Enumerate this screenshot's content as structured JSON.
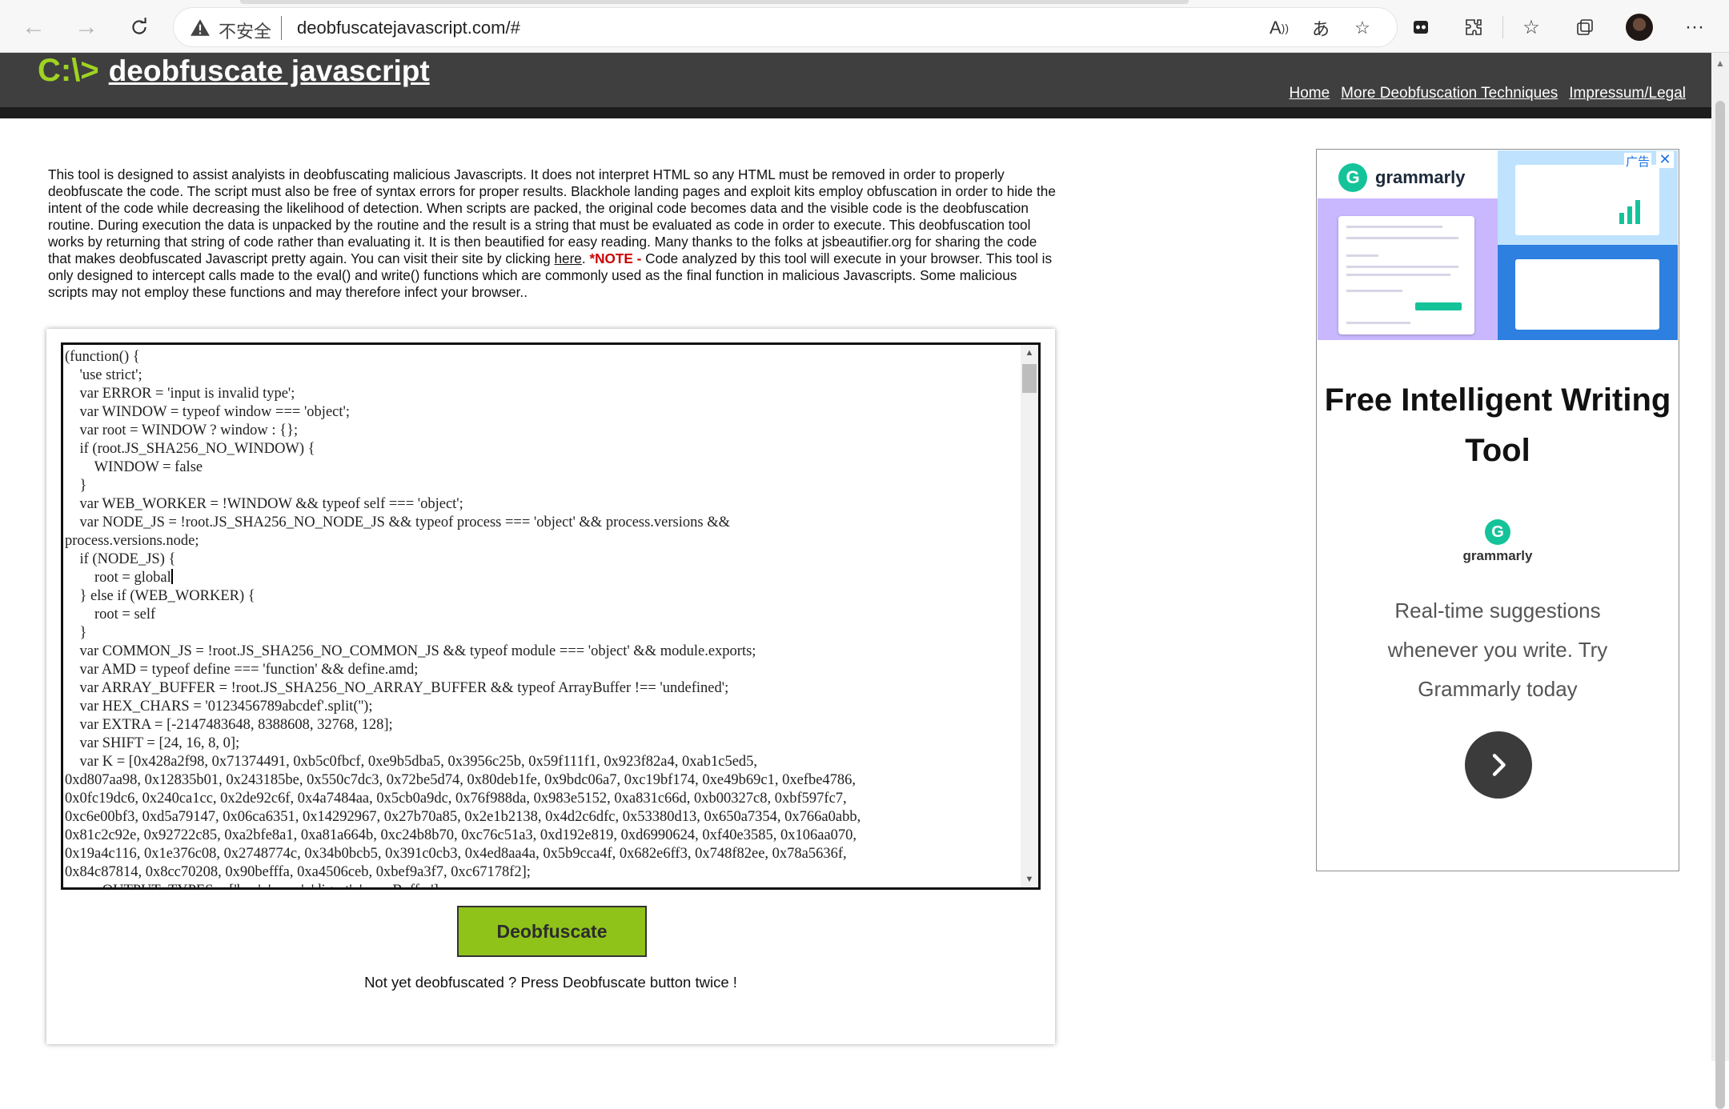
{
  "browser": {
    "back_icon": "back-arrow-icon",
    "forward_icon": "forward-arrow-icon",
    "reload_icon": "reload-icon",
    "security_label": "不安全",
    "url": "deobfuscatejavascript.com/#"
  },
  "site": {
    "logo_prompt": "C:\\>",
    "title": "deobfuscate javascript",
    "nav": [
      "Home",
      "More Deobfuscation Techniques",
      "Impressum/Legal"
    ]
  },
  "intro": {
    "text_before_link": "This tool is designed to assist analyists in deobfuscating malicious Javascripts. It does not interpret HTML so any HTML must be removed in order to properly deobfuscate the code. The script must also be free of syntax errors for proper results. Blackhole landing pages and exploit kits employ obfuscation in order to hide the intent of the code while decreasing the likelihood of detection. When scripts are packed, the original code becomes data and the visible code is the deobfuscation routine. During execution the data is unpacked by the routine and the result is a string that must be evaluated as code in order to execute. This deobfuscation tool works by returning that string of code rather than evaluating it. It is then beautified for easy reading. Many thanks to the folks at jsbeautifier.org for sharing the code that makes deobfuscated Javascript pretty again. You can visit their site by clicking ",
    "link": "here",
    "after_link": ". ",
    "note_label": "*NOTE -",
    "text_after_note": " Code analyzed by this tool will execute in your browser. This tool is only designed to intercept calls made to the eval() and write() functions which are commonly used as the final function in malicious Javascripts. Some malicious scripts may not employ these functions and may therefore infect your browser.."
  },
  "editor": {
    "code_before_caret": "(function() {\n    'use strict';\n    var ERROR = 'input is invalid type';\n    var WINDOW = typeof window === 'object';\n    var root = WINDOW ? window : {};\n    if (root.JS_SHA256_NO_WINDOW) {\n        WINDOW = false\n    }\n    var WEB_WORKER = !WINDOW && typeof self === 'object';\n    var NODE_JS = !root.JS_SHA256_NO_NODE_JS && typeof process === 'object' && process.versions &&\nprocess.versions.node;\n    if (NODE_JS) {\n        root = global",
    "code_after_caret": "\n    } else if (WEB_WORKER) {\n        root = self\n    }\n    var COMMON_JS = !root.JS_SHA256_NO_COMMON_JS && typeof module === 'object' && module.exports;\n    var AMD = typeof define === 'function' && define.amd;\n    var ARRAY_BUFFER = !root.JS_SHA256_NO_ARRAY_BUFFER && typeof ArrayBuffer !== 'undefined';\n    var HEX_CHARS = '0123456789abcdef'.split('');\n    var EXTRA = [-2147483648, 8388608, 32768, 128];\n    var SHIFT = [24, 16, 8, 0];\n    var K = [0x428a2f98, 0x71374491, 0xb5c0fbcf, 0xe9b5dba5, 0x3956c25b, 0x59f111f1, 0x923f82a4, 0xab1c5ed5,\n0xd807aa98, 0x12835b01, 0x243185be, 0x550c7dc3, 0x72be5d74, 0x80deb1fe, 0x9bdc06a7, 0xc19bf174, 0xe49b69c1, 0xefbe4786,\n0x0fc19dc6, 0x240ca1cc, 0x2de92c6f, 0x4a7484aa, 0x5cb0a9dc, 0x76f988da, 0x983e5152, 0xa831c66d, 0xb00327c8, 0xbf597fc7,\n0xc6e00bf3, 0xd5a79147, 0x06ca6351, 0x14292967, 0x27b70a85, 0x2e1b2138, 0x4d2c6dfc, 0x53380d13, 0x650a7354, 0x766a0abb,\n0x81c2c92e, 0x92722c85, 0xa2bfe8a1, 0xa81a664b, 0xc24b8b70, 0xc76c51a3, 0xd192e819, 0xd6990624, 0xf40e3585, 0x106aa070,\n0x19a4c116, 0x1e376c08, 0x2748774c, 0x34b0bcb5, 0x391c0cb3, 0x4ed8aa4a, 0x5b9cca4f, 0x682e6ff3, 0x748f82ee, 0x78a5636f,\n0x84c87814, 0x8cc70208, 0x90befffa, 0xa4506ceb, 0xbef9a3f7, 0xc67178f2];\n    var OUTPUT_TYPES = ['hex', 'array', 'digest', 'arrayBuffer'];"
  },
  "tool": {
    "button_label": "Deobfuscate",
    "status": "Not yet deobfuscated ? Press Deobfuscate button twice !"
  },
  "ad": {
    "brand": "grammarly",
    "badge": "广告",
    "close": "✕",
    "headline": "Free Intelligent Writing Tool",
    "brand_small": "grammarly",
    "body": "Real-time suggestions whenever you write. Try Grammarly today",
    "logo_letter": "G",
    "next_icon": "chevron-right-icon",
    "brand_color": "#15c39a"
  },
  "colors": {
    "header_bg": "#3f3f3f",
    "logo_accent": "#9fd321",
    "button_bg": "#8fc31a",
    "note_red": "#cc0000"
  }
}
